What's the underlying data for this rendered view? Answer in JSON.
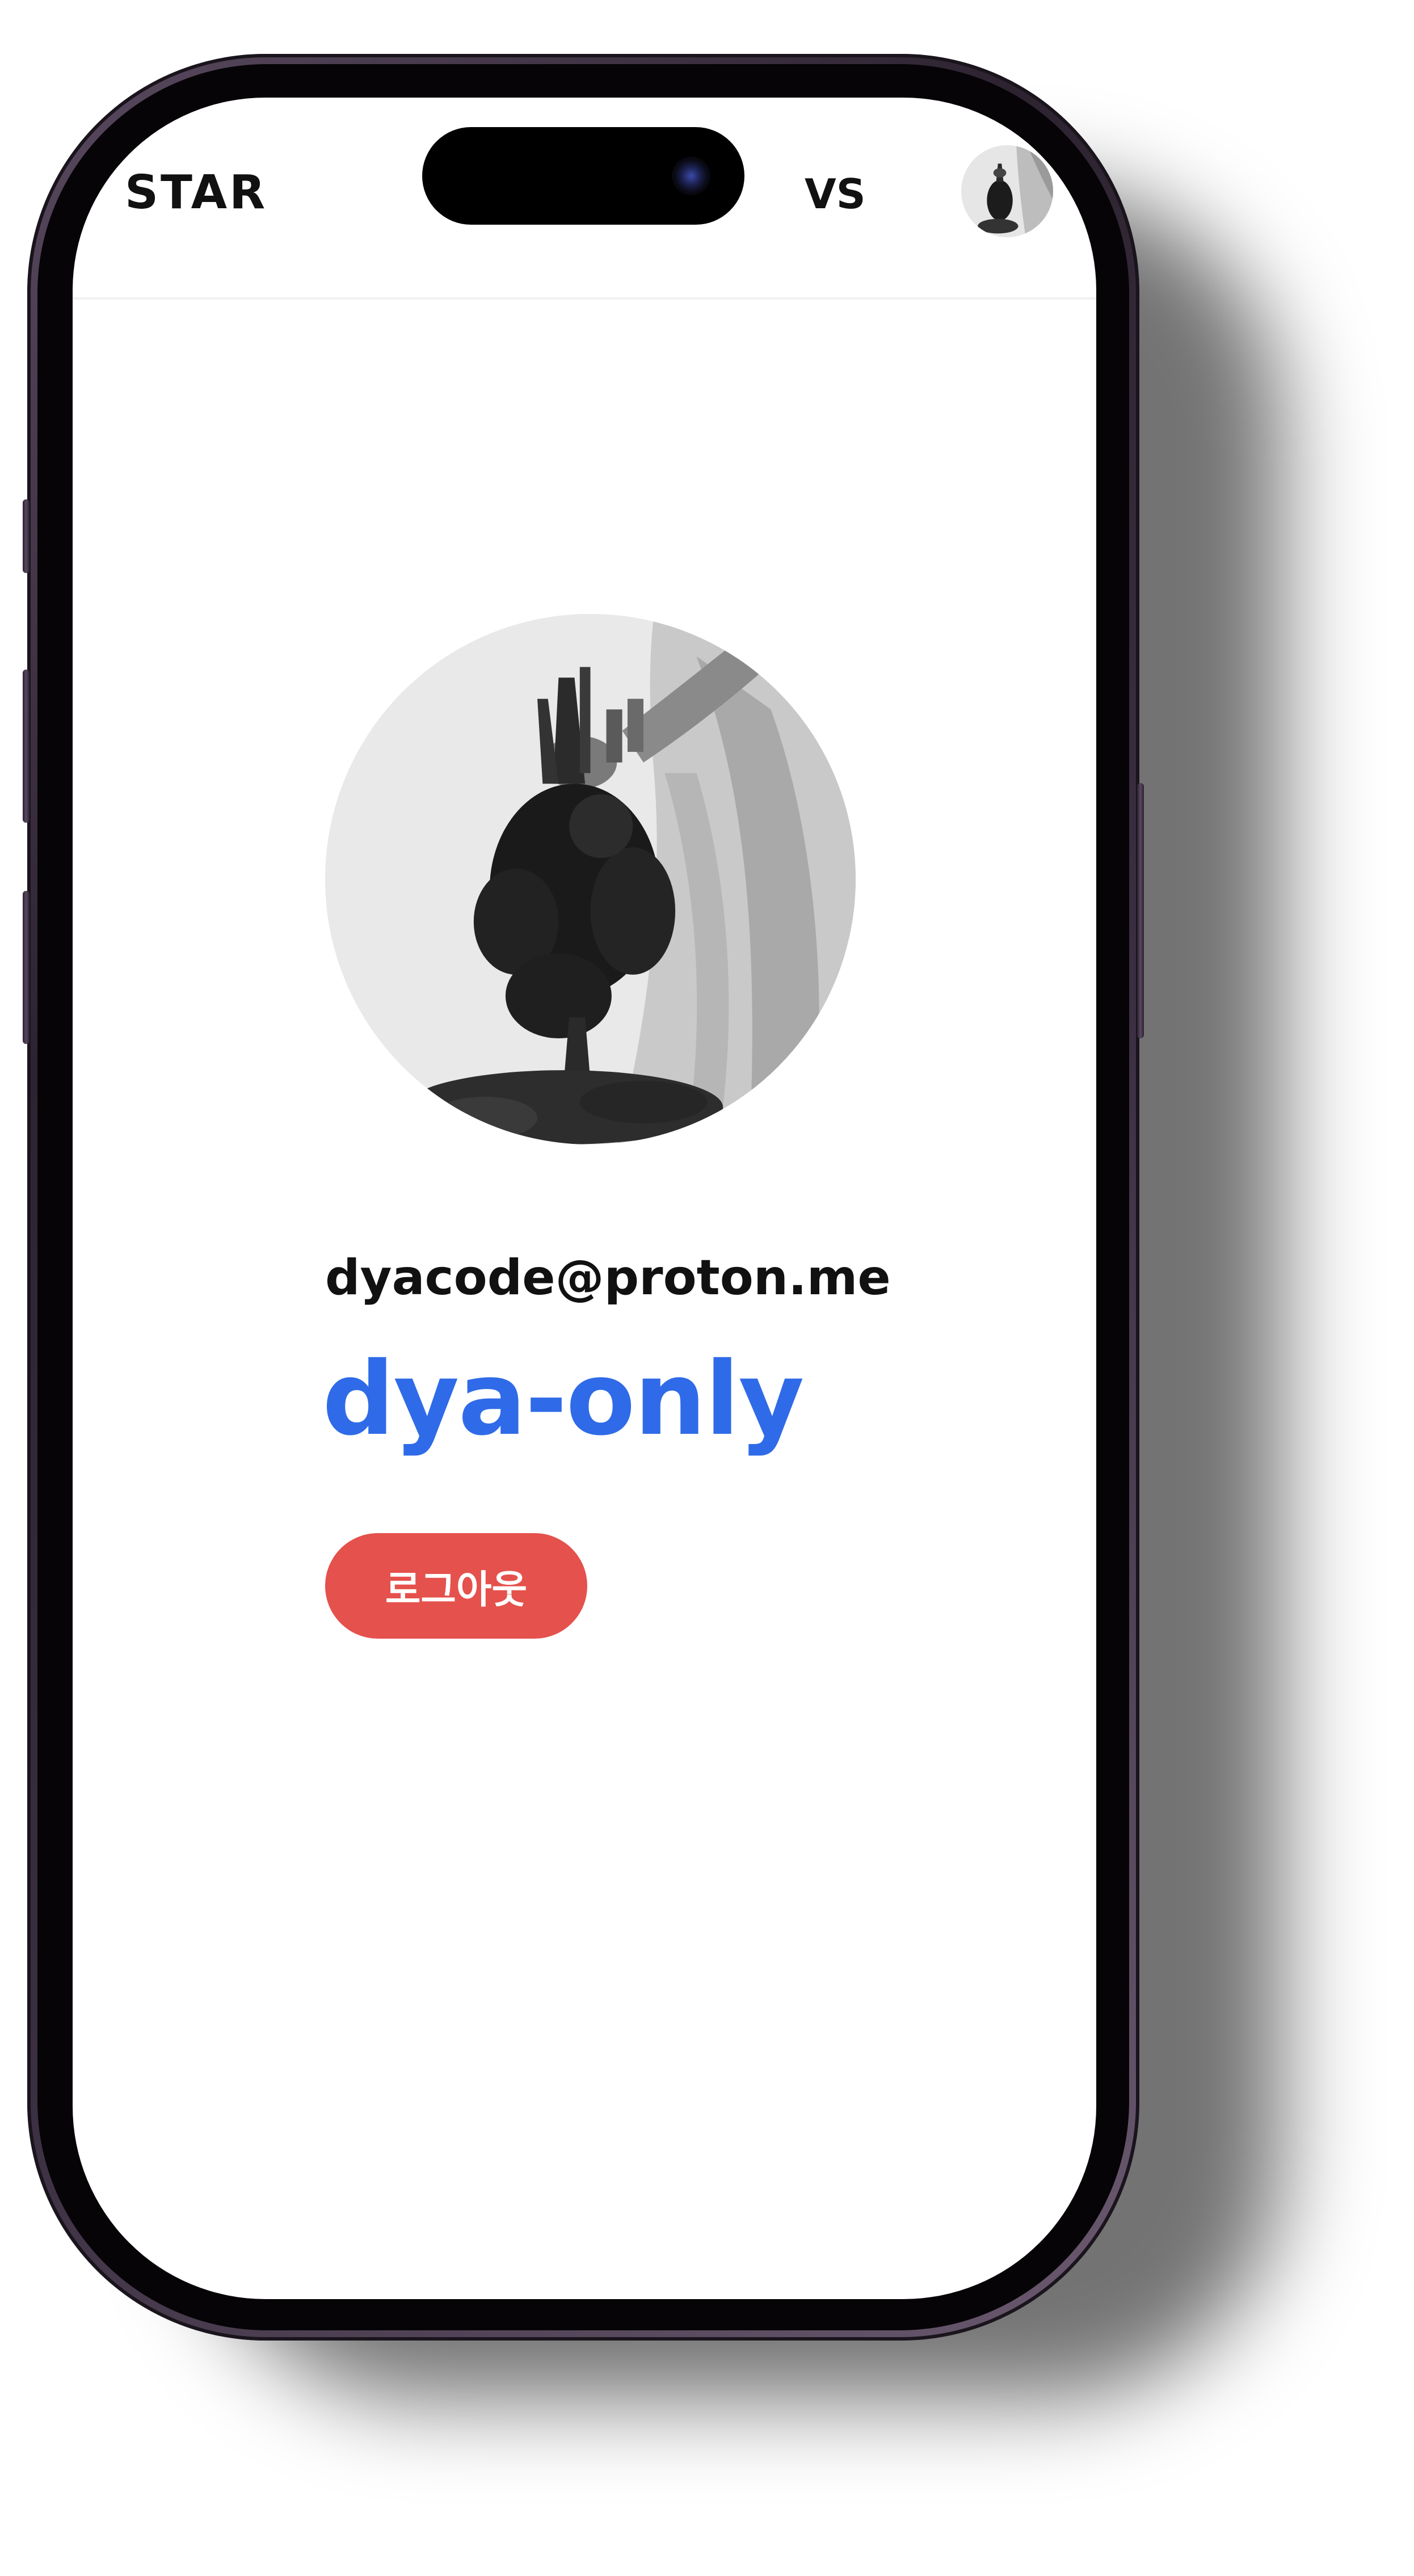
{
  "header": {
    "logo": "STAR",
    "vs_link": "VS",
    "avatar_icon": "user-avatar-icon"
  },
  "profile": {
    "avatar_icon": "profile-photo-icon",
    "email": "dyacode@proton.me",
    "username": "dya-only",
    "logout_label": "로그아웃"
  },
  "colors": {
    "accent": "#2f6be8",
    "logout": "#e5514c",
    "text": "#111111",
    "background": "#ffffff",
    "phone_frame": "#3a2f40"
  }
}
